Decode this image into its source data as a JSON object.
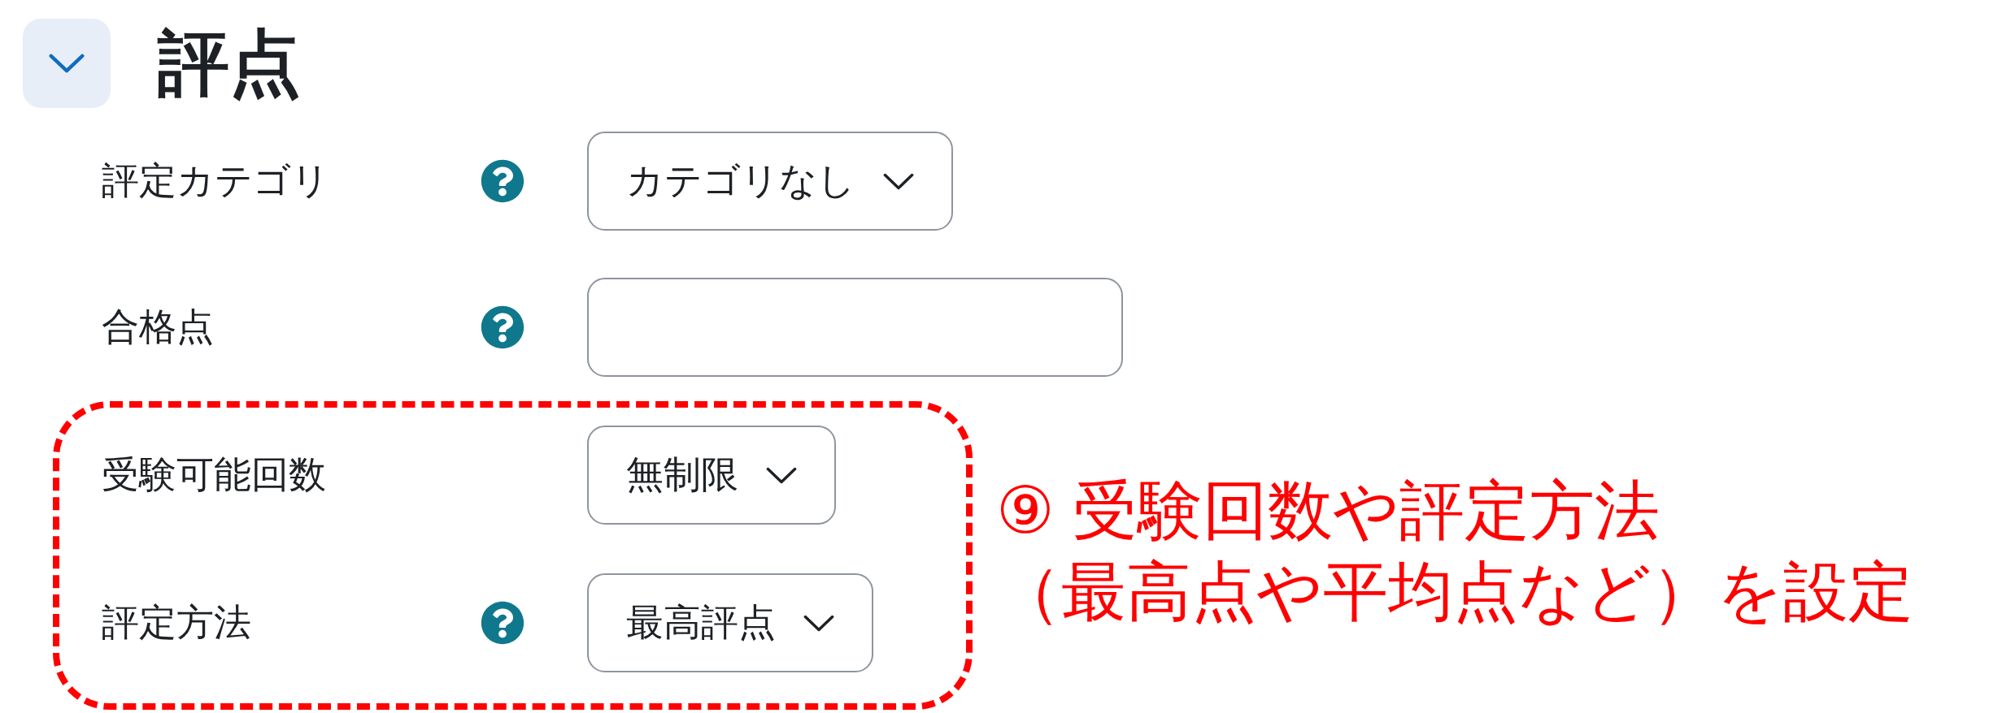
{
  "section": {
    "title": "評点",
    "expanded": true
  },
  "fields": [
    {
      "kind": "select",
      "label": "評定カテゴリ",
      "help": true,
      "value": "カテゴリなし"
    },
    {
      "kind": "text",
      "label": "合格点",
      "help": true
    }
  ],
  "callout": {
    "fields": [
      {
        "kind": "select",
        "label": "受験可能回数",
        "help": false,
        "value": "無制限"
      },
      {
        "kind": "select",
        "label": "評定方法",
        "help": true,
        "value": "最高評点"
      }
    ],
    "note": [
      "⑨ 受験回数や評定方法",
      "（最高点や平均点など）を設定"
    ]
  }
}
